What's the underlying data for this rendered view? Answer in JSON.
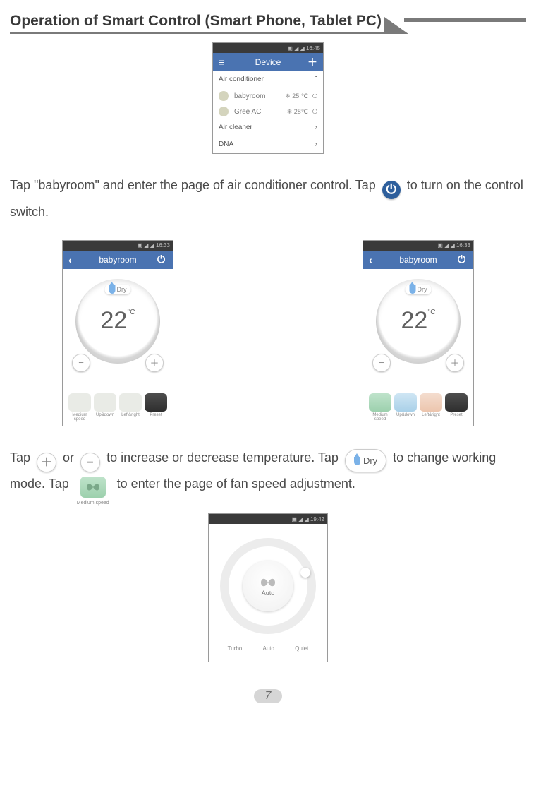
{
  "title": "Operation of Smart Control (Smart Phone, Tablet PC)",
  "status_time_device": "16:45",
  "status_time_control": "16:33",
  "status_time_fan": "19:42",
  "signal_glyphs": "▣ ◢ ◢",
  "device_header_left": "≡",
  "device_header_title": "Device",
  "device_header_right": "＋",
  "device_group1": "Air conditioner",
  "device_room1_name": "babyroom",
  "device_room1_temp": "❄ 25 ℃",
  "device_room2_name": "Gree AC",
  "device_room2_temp": "❄ 28℃",
  "device_group2": "Air cleaner",
  "device_group3": "DNA",
  "control_header_left": "‹",
  "control_header_title": "babyroom",
  "control_mode_label": "Dry",
  "control_temp": "22",
  "control_temp_unit": "°C",
  "control_tile1": "Medium speed",
  "control_tile2": "Up&down",
  "control_tile3": "Left&right",
  "control_tile4": "Preset",
  "fan_centre_label": "Auto",
  "fan_opt1": "Turbo",
  "fan_opt2": "Auto",
  "fan_opt3": "Quiet",
  "para1_a": "Tap \"babyroom\" and enter the page of air conditioner control. Tap ",
  "para1_b": " to turn on the control switch.",
  "para2_a": "Tap ",
  "para2_b": " or ",
  "para2_c": " to increase or decrease temperature. Tap ",
  "para2_d": " to change working mode. Tap ",
  "para2_e": " to enter the page of fan speed adjustment.",
  "dry_label": "Dry",
  "fan_btn_sub": "Medium speed",
  "page_number": "7"
}
